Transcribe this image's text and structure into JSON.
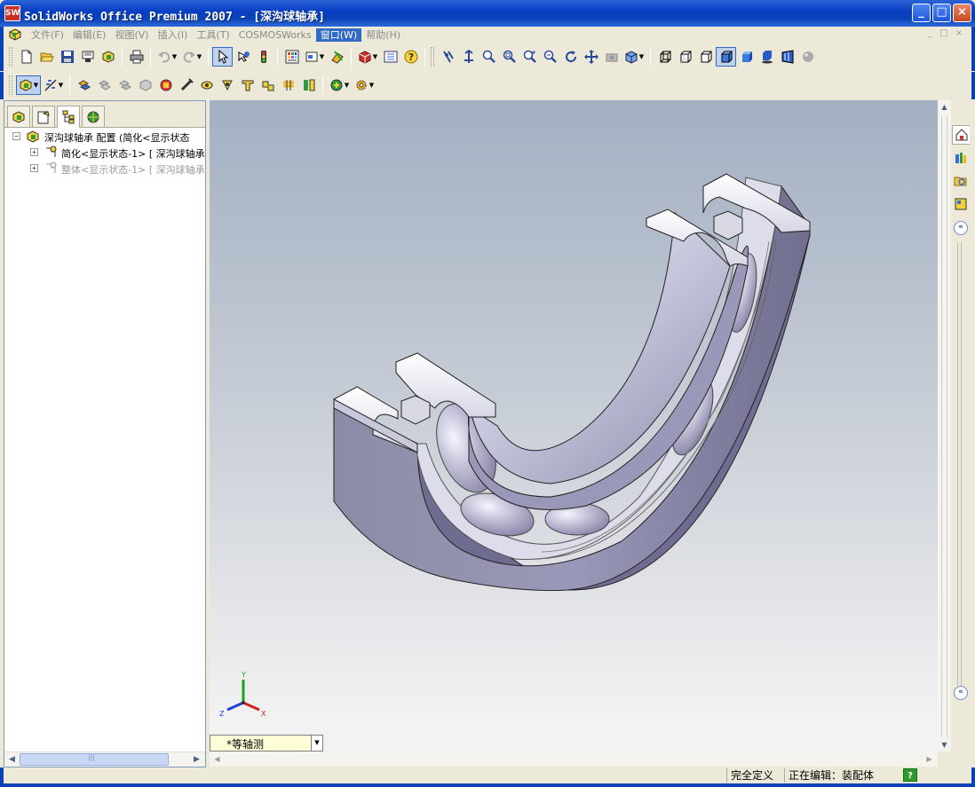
{
  "window": {
    "logo_text": "SW",
    "title": "SolidWorks Office Premium 2007 - [深沟球轴承]",
    "controls": {
      "minimize": "_",
      "maximize": "□",
      "close": "×"
    }
  },
  "menu": {
    "items": [
      "文件(F)",
      "编辑(E)",
      "视图(V)",
      "插入(I)",
      "工具(T)",
      "COSMOSWorks",
      "窗口(W)",
      "帮助(H)"
    ],
    "active_item": "窗口(W)",
    "mdi_controls": [
      "_",
      "□",
      "×"
    ]
  },
  "toolbar_standard": {
    "icons": [
      "new-document-icon",
      "open-folder-icon",
      "save-icon",
      "print-preview-icon",
      "assembly-options-icon",
      "printer-icon",
      "undo-icon",
      "redo-icon",
      "select-arrow-icon",
      "rebuild-icon",
      "traffic-light-icon",
      "color-grid-icon",
      "view-orientation-icon",
      "section-view-icon",
      "appearance-cube-icon",
      "toggle-list-icon",
      "help-icon"
    ]
  },
  "toolbar_view": {
    "icons": [
      "view-select-icon",
      "point-orient-icon",
      "zoom-fit-icon",
      "zoom-window-icon",
      "zoom-in-out-icon",
      "zoom-selection-icon",
      "rotate-icon",
      "pan-icon",
      "camera-icon",
      "display-style-icon",
      "wireframe-icon",
      "hidden-lines-visible-icon",
      "hidden-lines-removed-icon",
      "shaded-edges-icon",
      "shaded-icon",
      "shadow-icon",
      "perspective-icon",
      "realview-icon"
    ]
  },
  "toolbar_assembly": {
    "icons": [
      "edit-component-icon",
      "insert-component-icon",
      "mate-icon",
      "move-component-icon",
      "rotate-component-icon",
      "smart-fasteners-icon",
      "explode-view-icon",
      "interference-icon",
      "collision-icon",
      "dynamic-clearance-icon",
      "physical-dynamics-icon",
      "assembly-features-icon",
      "reference-geometry-icon",
      "mate-reference-icon"
    ]
  },
  "feature_tree": {
    "tabs": [
      "feature-manager-icon",
      "property-manager-icon",
      "configuration-manager-icon",
      "dimxpert-icon"
    ],
    "active_tab": 2,
    "rows": [
      {
        "expander": "−",
        "label": "深沟球轴承 配置 (简化<显示状态",
        "dim": false,
        "level": 0
      },
      {
        "expander": "+",
        "label": "简化<显示状态-1> [ 深沟球轴承",
        "dim": false,
        "level": 1
      },
      {
        "expander": "+",
        "label": "整体<显示状态-1> [ 深沟球轴承",
        "dim": true,
        "level": 1
      }
    ],
    "scroll_grip": "|||"
  },
  "viewport": {
    "standard_view": "*等轴测",
    "triad_axes": {
      "x": "X",
      "y": "Y",
      "z": "Z"
    },
    "colors": {
      "x_axis": "#d02020",
      "y_axis": "#20a020",
      "z_axis": "#2040d0"
    }
  },
  "task_pane": {
    "icons": [
      "solidworks-resources-icon",
      "design-library-icon",
      "file-explorer-icon",
      "view-palette-icon"
    ],
    "collapse_glyph": "«"
  },
  "status": {
    "definition": "完全定义",
    "editing": "正在编辑：装配体",
    "help_glyph": "?"
  }
}
